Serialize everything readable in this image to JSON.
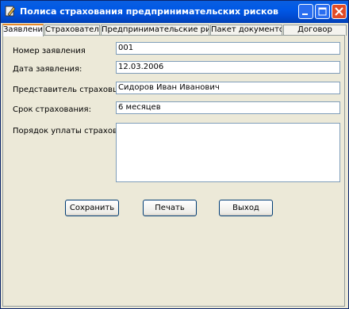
{
  "window": {
    "title": "Полиса страхования предпринимательских рисков"
  },
  "tabs": [
    {
      "label": "Заявление",
      "active": true
    },
    {
      "label": "Страхователь",
      "active": false
    },
    {
      "label": "Предпринимательские риски",
      "active": false
    },
    {
      "label": "Пакет документов",
      "active": false
    },
    {
      "label": "Договор",
      "active": false
    }
  ],
  "form": {
    "number_label": "Номер заявления",
    "number_value": "001",
    "date_label": "Дата заявления:",
    "date_value": "12.03.2006",
    "agent_label": "Представитель страховщика",
    "agent_value": "Сидоров Иван Иванович",
    "term_label": "Срок страхования:",
    "term_value": "6 месяцев",
    "payment_label": "Порядок уплаты страховой премии:",
    "payment_value": ""
  },
  "buttons": {
    "save": "Сохранить",
    "print": "Печать",
    "exit": "Выход"
  },
  "icons": [
    "app-icon",
    "minimize-icon",
    "maximize-icon",
    "close-icon"
  ]
}
